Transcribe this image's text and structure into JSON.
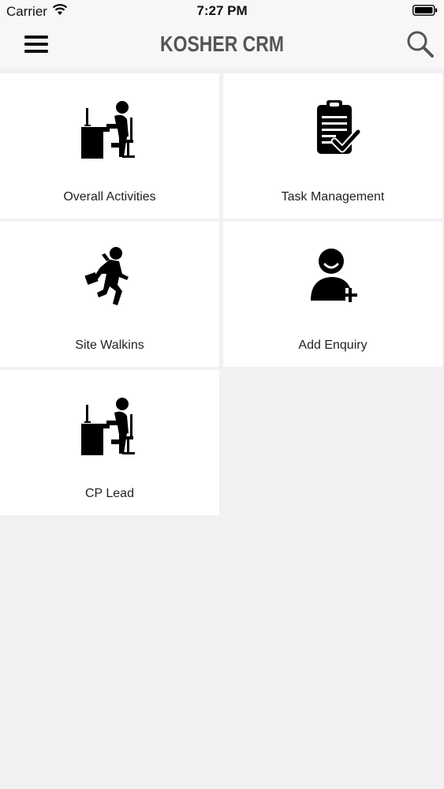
{
  "status_bar": {
    "carrier": "Carrier",
    "time": "7:27 PM",
    "wifi_icon": "wifi-icon",
    "battery_icon": "battery-icon"
  },
  "nav_bar": {
    "title": "KOSHER CRM",
    "menu_icon": "hamburger-menu-icon",
    "search_icon": "search-icon"
  },
  "tiles": [
    {
      "label": "Overall Activities",
      "icon": "person-at-desk-icon"
    },
    {
      "label": "Task Management",
      "icon": "clipboard-check-icon"
    },
    {
      "label": "Site Walkins",
      "icon": "running-man-icon"
    },
    {
      "label": "Add Enquiry",
      "icon": "add-user-icon"
    },
    {
      "label": "CP Lead",
      "icon": "person-at-desk-icon"
    }
  ]
}
